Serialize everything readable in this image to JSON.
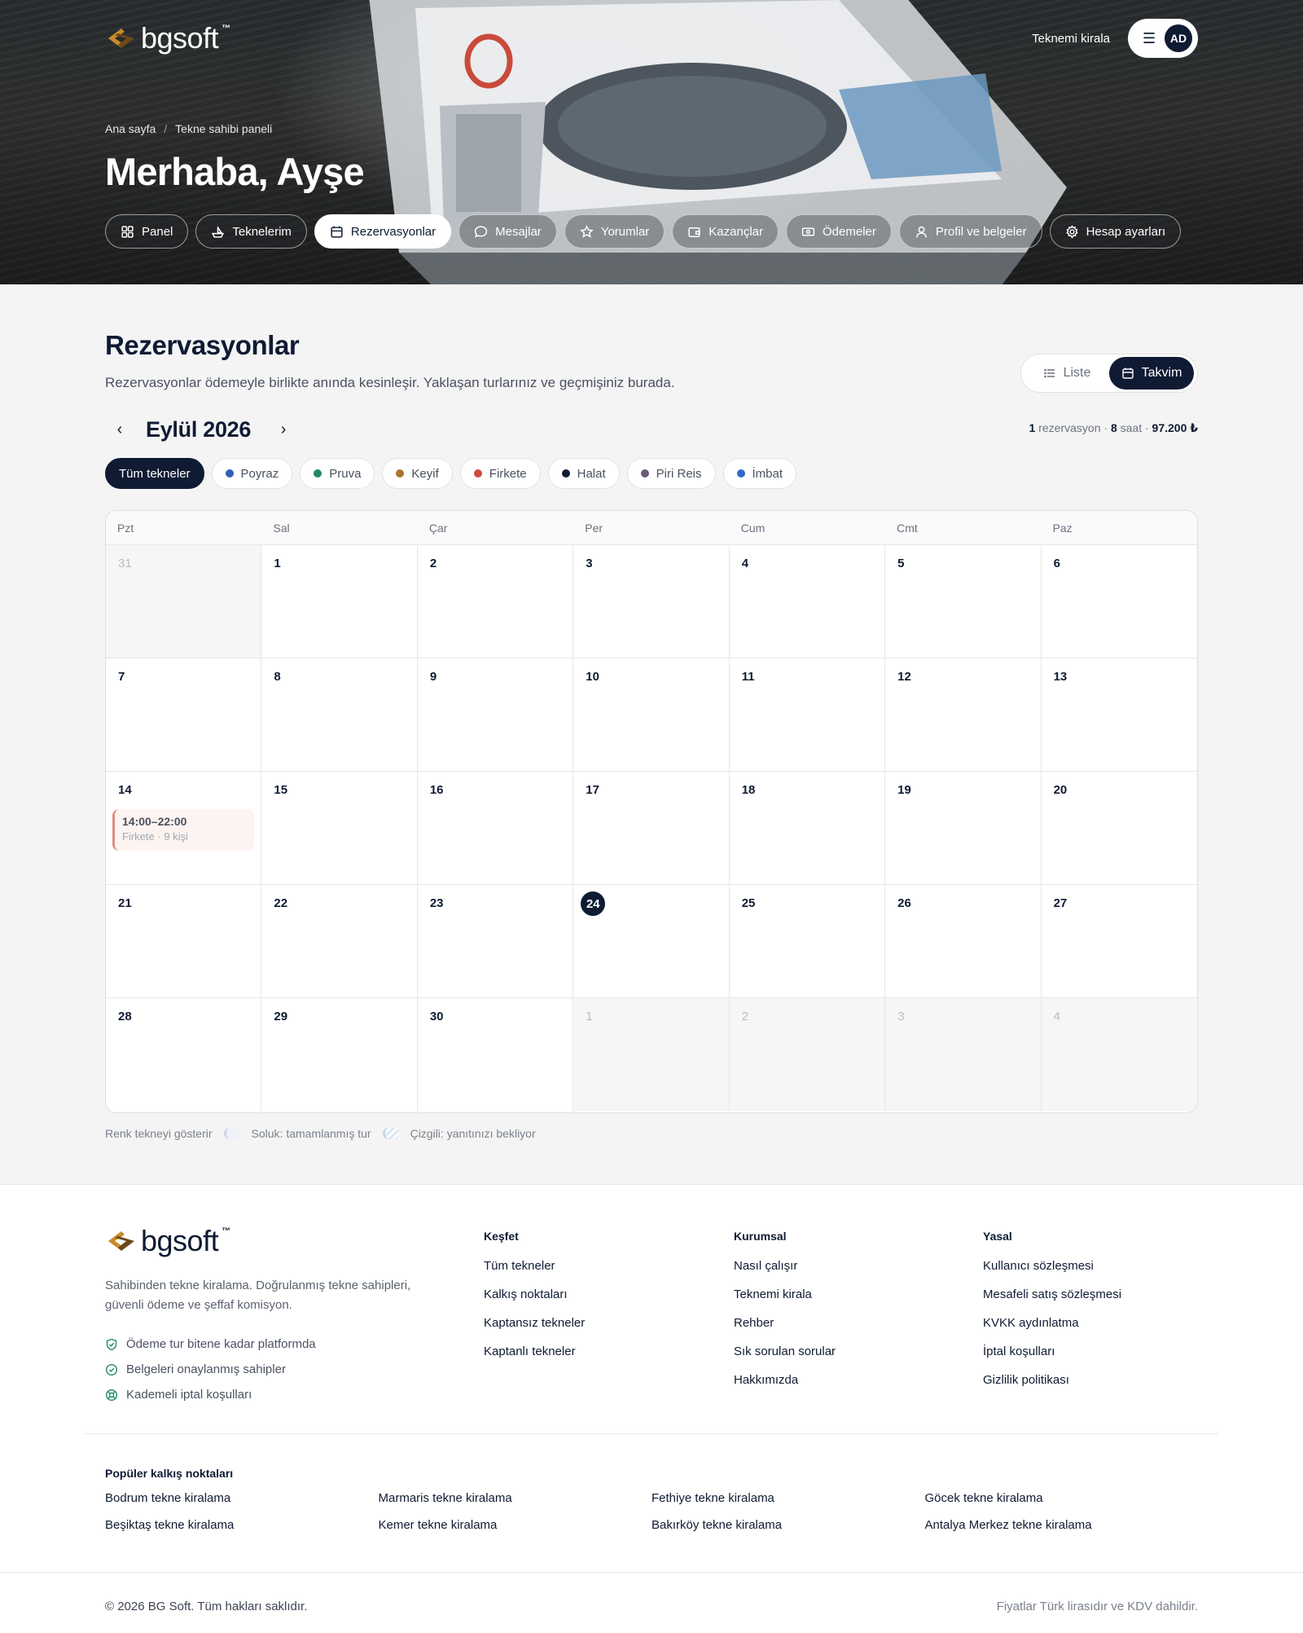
{
  "brand": {
    "name": "bgsoft",
    "tm": "™",
    "accent": "#c98a2b",
    "navy": "#0f1b33"
  },
  "header": {
    "rent_link": "Teknemi kirala",
    "avatar_initials": "AD",
    "breadcrumb": [
      "Ana sayfa",
      "Tekne sahibi paneli"
    ],
    "greeting": "Merhaba, Ayşe",
    "tabs": [
      {
        "label": "Panel",
        "icon": "grid-icon"
      },
      {
        "label": "Teknelerim",
        "icon": "boat-icon"
      },
      {
        "label": "Rezervasyonlar",
        "icon": "calendar-icon",
        "active": true
      },
      {
        "label": "Mesajlar",
        "icon": "chat-bubble-icon"
      },
      {
        "label": "Yorumlar",
        "icon": "star-icon"
      },
      {
        "label": "Kazançlar",
        "icon": "wallet-icon"
      },
      {
        "label": "Ödemeler",
        "icon": "banknote-icon"
      },
      {
        "label": "Profil ve belgeler",
        "icon": "user-icon"
      },
      {
        "label": "Hesap ayarları",
        "icon": "gear-icon"
      }
    ]
  },
  "main": {
    "title": "Rezervasyonlar",
    "subtitle": "Rezervasyonlar ödemeyle birlikte anında kesinleşir. Yaklaşan turlarınız ve geçmişiniz burada.",
    "view_toggle": {
      "list": "Liste",
      "calendar": "Takvim",
      "active": "calendar"
    },
    "month": "Eylül 2026",
    "summary": {
      "count": "1",
      "count_label": "rezervasyon",
      "hours": "8",
      "hours_label": "saat",
      "total": "97.200 ₺",
      "sep": "·"
    },
    "filters": [
      {
        "label": "Tüm tekneler",
        "active": true
      },
      {
        "label": "Poyraz",
        "color": "#2f5fb3"
      },
      {
        "label": "Pruva",
        "color": "#1f8a6a"
      },
      {
        "label": "Keyif",
        "color": "#a9752a"
      },
      {
        "label": "Firkete",
        "color": "#cf4a3c"
      },
      {
        "label": "Halat",
        "color": "#0f1b33"
      },
      {
        "label": "Piri Reis",
        "color": "#6b5a78"
      },
      {
        "label": "İmbat",
        "color": "#2f68c8"
      }
    ],
    "weekdays": [
      "Pzt",
      "Sal",
      "Çar",
      "Per",
      "Cum",
      "Cmt",
      "Paz"
    ],
    "days": [
      {
        "n": "31",
        "muted": true
      },
      {
        "n": "1"
      },
      {
        "n": "2"
      },
      {
        "n": "3"
      },
      {
        "n": "4"
      },
      {
        "n": "5"
      },
      {
        "n": "6"
      },
      {
        "n": "7"
      },
      {
        "n": "8"
      },
      {
        "n": "9"
      },
      {
        "n": "10"
      },
      {
        "n": "11"
      },
      {
        "n": "12"
      },
      {
        "n": "13"
      },
      {
        "n": "14",
        "event": {
          "time": "14:00–22:00",
          "boat": "Firkete",
          "guests": "9 kişi"
        }
      },
      {
        "n": "15"
      },
      {
        "n": "16"
      },
      {
        "n": "17"
      },
      {
        "n": "18"
      },
      {
        "n": "19"
      },
      {
        "n": "20"
      },
      {
        "n": "21"
      },
      {
        "n": "22"
      },
      {
        "n": "23"
      },
      {
        "n": "24",
        "today": true
      },
      {
        "n": "25"
      },
      {
        "n": "26"
      },
      {
        "n": "27"
      },
      {
        "n": "28"
      },
      {
        "n": "29"
      },
      {
        "n": "30"
      },
      {
        "n": "1",
        "muted": true
      },
      {
        "n": "2",
        "muted": true
      },
      {
        "n": "3",
        "muted": true
      },
      {
        "n": "4",
        "muted": true
      }
    ],
    "legend": {
      "color_note": "Renk tekneyi gösterir",
      "faded": "Soluk: tamamlanmış tur",
      "striped": "Çizgili: yanıtınızı bekliyor"
    }
  },
  "footer": {
    "description": "Sahibinden tekne kiralama. Doğrulanmış tekne sahipleri, güvenli ödeme ve şeffaf komisyon.",
    "features": [
      {
        "label": "Ödeme tur bitene kadar platformda",
        "icon": "shield-check-icon"
      },
      {
        "label": "Belgeleri onaylanmış sahipler",
        "icon": "check-circle-icon"
      },
      {
        "label": "Kademeli iptal koşulları",
        "icon": "lifebuoy-icon"
      }
    ],
    "columns": [
      {
        "title": "Keşfet",
        "links": [
          "Tüm tekneler",
          "Kalkış noktaları",
          "Kaptansız tekneler",
          "Kaptanlı tekneler"
        ]
      },
      {
        "title": "Kurumsal",
        "links": [
          "Nasıl çalışır",
          "Teknemi kirala",
          "Rehber",
          "Sık sorulan sorular",
          "Hakkımızda"
        ]
      },
      {
        "title": "Yasal",
        "links": [
          "Kullanıcı sözleşmesi",
          "Mesafeli satış sözleşmesi",
          "KVKK aydınlatma",
          "İptal koşulları",
          "Gizlilik politikası"
        ]
      }
    ],
    "popular_title": "Popüler kalkış noktaları",
    "popular": [
      "Bodrum tekne kiralama",
      "Marmaris tekne kiralama",
      "Fethiye tekne kiralama",
      "Göcek tekne kiralama",
      "Beşiktaş tekne kiralama",
      "Kemer tekne kiralama",
      "Bakırköy tekne kiralama",
      "Antalya Merkez tekne kiralama"
    ],
    "copyright": "© 2026 BG Soft. Tüm hakları saklıdır.",
    "price_note": "Fiyatlar Türk lirasıdır ve KDV dahildir."
  }
}
